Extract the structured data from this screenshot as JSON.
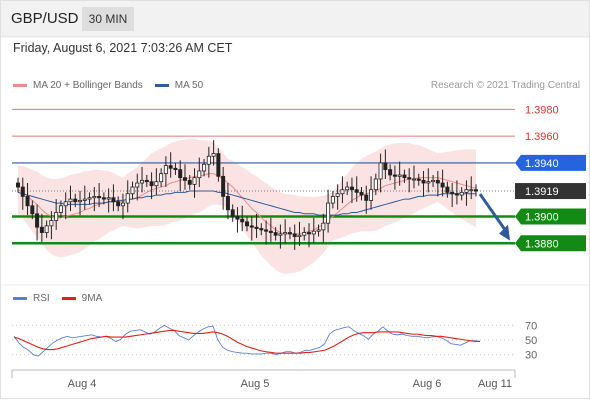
{
  "header": {
    "pair": "GBP/USD",
    "timeframe": "30 MIN"
  },
  "timestamp": "Friday, August 6, 2021 7:03:26 AM CET",
  "legend": {
    "main": [
      {
        "label": "MA 20 + Bollinger Bands",
        "color": "#f08a8a"
      },
      {
        "label": "MA 50",
        "color": "#2e5b9a"
      }
    ],
    "rsi": [
      {
        "label": "RSI",
        "color": "#5b7fd6"
      },
      {
        "label": "9MA",
        "color": "#e0201b"
      }
    ]
  },
  "credit": "Research © 2021 Trading Central",
  "colors": {
    "resistance": "#e87878",
    "pivot": "#2464dc",
    "support": "#138a13",
    "current": "#333333",
    "arrow": "#2e5b9a"
  },
  "chart_data": [
    {
      "type": "candlestick",
      "title": "GBP/USD",
      "timeframe": "30 MIN",
      "ylim": [
        1.3866,
        1.399
      ],
      "x_ticks": [
        "Aug 4",
        "Aug 5",
        "Aug 6",
        "Aug 11"
      ],
      "levels": [
        {
          "value": 1.398,
          "label": "1.3980",
          "kind": "resistance"
        },
        {
          "value": 1.396,
          "label": "1.3960",
          "kind": "resistance"
        },
        {
          "value": 1.394,
          "label": "1.3940",
          "kind": "pivot"
        },
        {
          "value": 1.3919,
          "label": "1.3919",
          "kind": "current"
        },
        {
          "value": 1.39,
          "label": "1.3900",
          "kind": "support"
        },
        {
          "value": 1.388,
          "label": "1.3880",
          "kind": "support"
        }
      ],
      "close": [
        1.3922,
        1.3915,
        1.3908,
        1.3902,
        1.3892,
        1.3888,
        1.3893,
        1.3897,
        1.3903,
        1.3908,
        1.3911,
        1.3913,
        1.3911,
        1.3912,
        1.3913,
        1.3914,
        1.3915,
        1.3914,
        1.3913,
        1.3914,
        1.3911,
        1.3908,
        1.391,
        1.3917,
        1.3922,
        1.3925,
        1.3927,
        1.3926,
        1.3923,
        1.3926,
        1.3932,
        1.3938,
        1.3936,
        1.3935,
        1.3929,
        1.3927,
        1.3924,
        1.3929,
        1.3934,
        1.3939,
        1.3945,
        1.3947,
        1.393,
        1.3915,
        1.3905,
        1.39,
        1.3898,
        1.3896,
        1.3893,
        1.3892,
        1.3891,
        1.389,
        1.3889,
        1.3888,
        1.3886,
        1.3887,
        1.3888,
        1.3887,
        1.3885,
        1.3886,
        1.3888,
        1.3887,
        1.3889,
        1.389,
        1.3895,
        1.391,
        1.3915,
        1.3917,
        1.392,
        1.3922,
        1.392,
        1.3918,
        1.3916,
        1.3912,
        1.392,
        1.3928,
        1.394,
        1.3935,
        1.3931,
        1.393,
        1.3931,
        1.3929,
        1.3928,
        1.3928,
        1.3927,
        1.3925,
        1.3926,
        1.3927,
        1.3925,
        1.3922,
        1.3918,
        1.3917,
        1.3916,
        1.3918,
        1.392,
        1.392,
        1.3919
      ],
      "ma20": [
        1.392,
        1.3918,
        1.3915,
        1.3912,
        1.3909,
        1.3905,
        1.3902,
        1.39,
        1.3899,
        1.3899,
        1.39,
        1.3901,
        1.3902,
        1.3903,
        1.3905,
        1.3906,
        1.3908,
        1.3909,
        1.391,
        1.3911,
        1.3911,
        1.3911,
        1.3911,
        1.3912,
        1.3913,
        1.3914,
        1.3916,
        1.3918,
        1.392,
        1.3921,
        1.3922,
        1.3923,
        1.3925,
        1.3926,
        1.3927,
        1.3928,
        1.3929,
        1.393,
        1.393,
        1.3931,
        1.3932,
        1.3932,
        1.393,
        1.3928,
        1.3925,
        1.3922,
        1.3918,
        1.3914,
        1.391,
        1.3906,
        1.3903,
        1.3899,
        1.3896,
        1.3893,
        1.389,
        1.3888,
        1.3887,
        1.3887,
        1.3887,
        1.3887,
        1.3888,
        1.3889,
        1.389,
        1.3892,
        1.3894,
        1.3897,
        1.39,
        1.3903,
        1.3906,
        1.3909,
        1.3912,
        1.3914,
        1.3916,
        1.3917,
        1.3918,
        1.3919,
        1.3921,
        1.3923,
        1.3924,
        1.3925,
        1.3926,
        1.3927,
        1.3928,
        1.3928,
        1.3929,
        1.3929,
        1.3929,
        1.3929,
        1.3929,
        1.3928,
        1.3927,
        1.3926,
        1.3925,
        1.3924,
        1.3923,
        1.3922,
        1.3921
      ],
      "ma50": [
        1.3918,
        1.3917,
        1.3916,
        1.3915,
        1.3914,
        1.3913,
        1.3912,
        1.3911,
        1.391,
        1.391,
        1.3909,
        1.3909,
        1.3909,
        1.3909,
        1.3909,
        1.3909,
        1.391,
        1.391,
        1.391,
        1.3911,
        1.3911,
        1.3912,
        1.3912,
        1.3913,
        1.3913,
        1.3914,
        1.3914,
        1.3915,
        1.3915,
        1.3916,
        1.3916,
        1.3917,
        1.3917,
        1.3918,
        1.3918,
        1.3918,
        1.3919,
        1.3919,
        1.3919,
        1.3919,
        1.3919,
        1.3919,
        1.3918,
        1.3918,
        1.3917,
        1.3916,
        1.3915,
        1.3914,
        1.3913,
        1.3912,
        1.3911,
        1.391,
        1.3909,
        1.3908,
        1.3907,
        1.3906,
        1.3905,
        1.3904,
        1.3903,
        1.3903,
        1.3902,
        1.3902,
        1.3902,
        1.3901,
        1.3901,
        1.3901,
        1.3901,
        1.3901,
        1.3902,
        1.3902,
        1.3903,
        1.3903,
        1.3904,
        1.3905,
        1.3906,
        1.3907,
        1.3908,
        1.3909,
        1.391,
        1.3911,
        1.3912,
        1.3913,
        1.3913,
        1.3914,
        1.3915,
        1.3915,
        1.3916,
        1.3916,
        1.3916,
        1.3917,
        1.3917,
        1.3917,
        1.3917,
        1.3917,
        1.3917,
        1.3917,
        1.3917
      ]
    },
    {
      "type": "line",
      "title": "RSI",
      "ylim": [
        20,
        80
      ],
      "y_ticks": [
        70,
        50,
        30
      ],
      "series": [
        {
          "name": "RSI",
          "values": [
            55,
            46,
            40,
            36,
            30,
            28,
            34,
            40,
            46,
            50,
            53,
            55,
            53,
            54,
            55,
            56,
            57,
            55,
            54,
            55,
            52,
            48,
            51,
            58,
            62,
            63,
            64,
            61,
            58,
            61,
            66,
            70,
            66,
            63,
            56,
            53,
            50,
            56,
            61,
            65,
            68,
            69,
            50,
            40,
            36,
            34,
            33,
            32,
            32,
            31,
            31,
            31,
            32,
            32,
            30,
            32,
            34,
            34,
            32,
            33,
            36,
            36,
            38,
            40,
            45,
            58,
            63,
            65,
            67,
            68,
            63,
            59,
            56,
            51,
            58,
            62,
            68,
            62,
            58,
            57,
            58,
            56,
            55,
            55,
            54,
            53,
            54,
            55,
            53,
            50,
            45,
            44,
            43,
            46,
            49,
            49,
            48
          ]
        },
        {
          "name": "9MA",
          "values": [
            54,
            52,
            49,
            46,
            43,
            40,
            38,
            37,
            37,
            38,
            40,
            42,
            44,
            46,
            48,
            50,
            52,
            53,
            54,
            55,
            54,
            54,
            54,
            54,
            55,
            56,
            57,
            58,
            59,
            60,
            61,
            62,
            63,
            63,
            62,
            61,
            60,
            59,
            59,
            59,
            60,
            61,
            60,
            58,
            55,
            51,
            47,
            44,
            41,
            39,
            37,
            35,
            34,
            33,
            32,
            32,
            32,
            32,
            32,
            32,
            33,
            33,
            34,
            35,
            36,
            39,
            42,
            46,
            50,
            54,
            57,
            59,
            60,
            60,
            60,
            61,
            61,
            61,
            61,
            61,
            60,
            59,
            58,
            58,
            57,
            56,
            56,
            55,
            55,
            54,
            53,
            52,
            51,
            50,
            49,
            48,
            48
          ]
        }
      ]
    }
  ]
}
